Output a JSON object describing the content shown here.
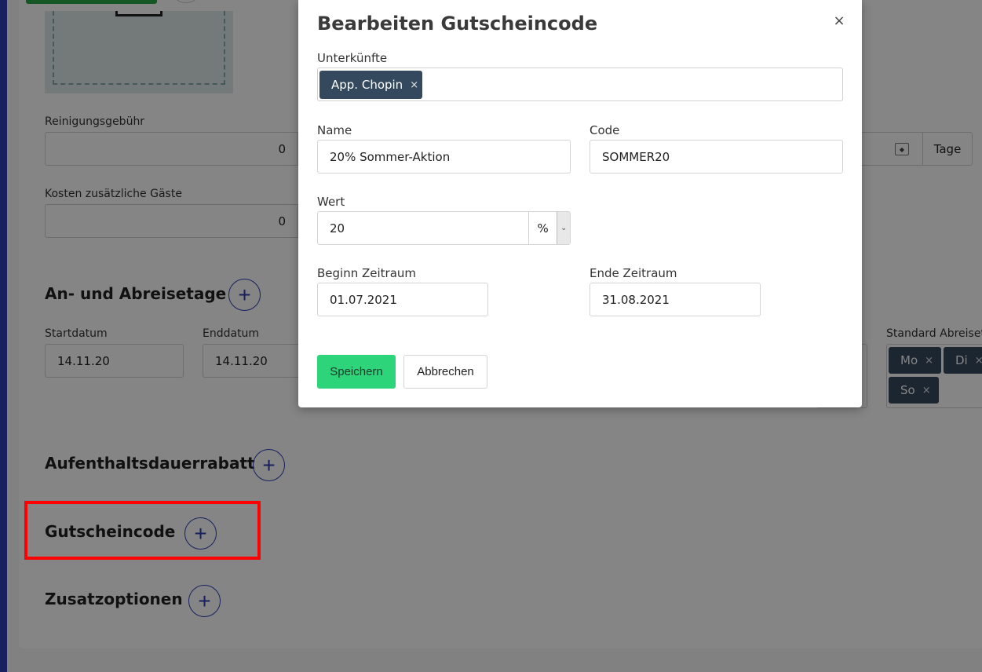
{
  "background": {
    "cleaning_fee": {
      "label": "Reinigungsgebühr",
      "value": "0"
    },
    "days_addon": "Tage",
    "extra_guests": {
      "label": "Kosten zusätzliche Gäste",
      "value": "0"
    },
    "arrival_section": {
      "title": "An- und Abreisetage"
    },
    "start_date": {
      "label": "Startdatum",
      "value": "14.11.20"
    },
    "end_date": {
      "label": "Enddatum",
      "value": "14.11.20"
    },
    "standard_departure": {
      "label": "Standard Abreiset",
      "tags": [
        "Mo",
        "Di",
        "So"
      ]
    },
    "stay_discount": {
      "title": "Aufenthaltsdauerrabatt"
    },
    "voucher": {
      "title": "Gutscheincode"
    },
    "extras": {
      "title": "Zusatzoptionen"
    }
  },
  "modal": {
    "title": "Bearbeiten Gutscheincode",
    "close": "×",
    "properties": {
      "label": "Unterkünfte",
      "tags": [
        "App. Chopin"
      ]
    },
    "name": {
      "label": "Name",
      "value": "20% Sommer-Aktion"
    },
    "code": {
      "label": "Code",
      "value": "SOMMER20"
    },
    "value": {
      "label": "Wert",
      "amount": "20",
      "unit": "%"
    },
    "period_start": {
      "label": "Beginn Zeitraum",
      "value": "01.07.2021"
    },
    "period_end": {
      "label": "Ende Zeitraum",
      "value": "31.08.2021"
    },
    "save": "Speichern",
    "cancel": "Abbrechen"
  },
  "colors": {
    "accent": "#2f3fb4",
    "save": "#2ed47a",
    "tag": "#34495e",
    "highlight": "#ff0000"
  }
}
